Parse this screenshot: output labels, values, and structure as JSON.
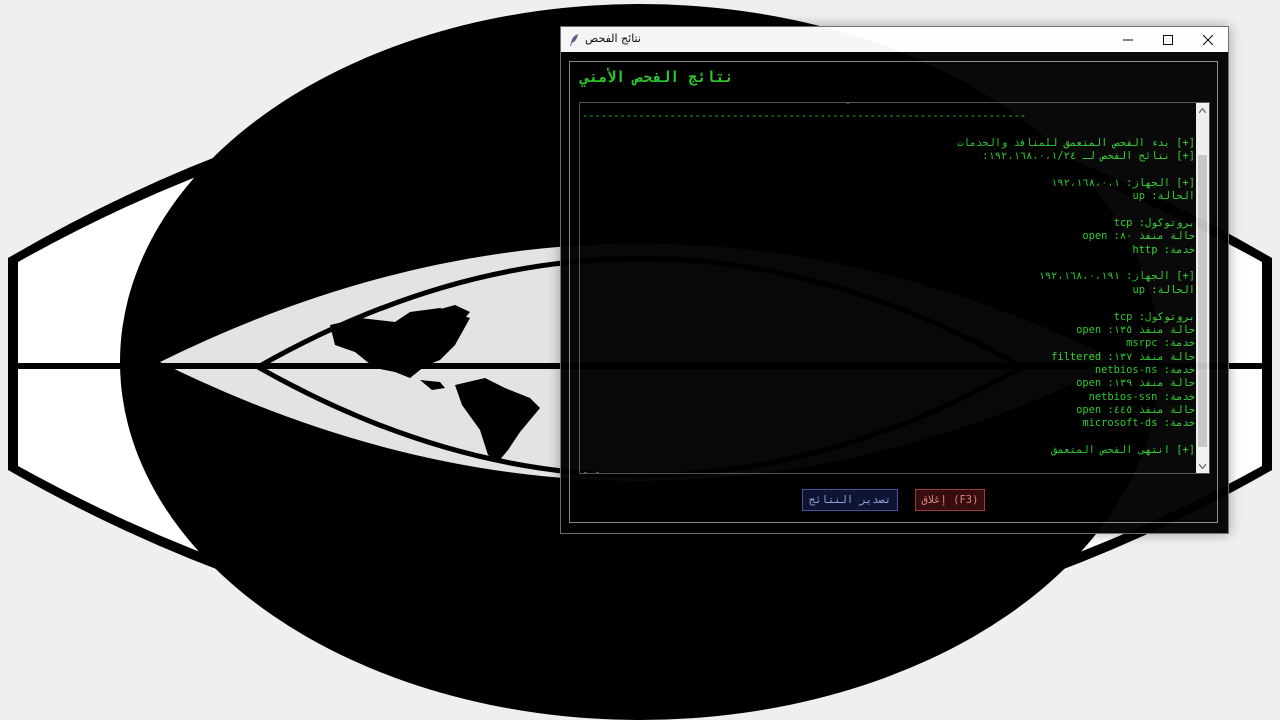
{
  "window": {
    "title": "نتائج الفحص",
    "header": "نتائج الفحص الأمني"
  },
  "results": {
    "lines": [
      "                                          -",
      "-----------------------------------------------------------------------",
      "",
      "[+] بدء الفحص المتعمق للمنافذ والخدمات",
      "[+] نتائج الفحص لـ ١٩٢،١٦٨،٠،١/٢٤:",
      "",
      "[+] الجهاز: ١٩٢،١٦٨،٠،١",
      "الحالة: up",
      "",
      "بروتوكول: tcp",
      "حالة منفذ ٨٠: open",
      "خدمة: http",
      "",
      "[+] الجهاز: ١٩٢،١٦٨،٠،١٩١",
      "الحالة: up",
      "",
      "بروتوكول: tcp",
      "حالة منفذ ١٣٥: open",
      "خدمة: msrpc",
      "حالة منفذ ١٣٧: filtered",
      "خدمة: netbios-ns",
      "حالة منفذ ١٣٩: open",
      "خدمة: netbios-ssn",
      "حالة منفذ ٤٤٥: open",
      "خدمة: microsoft-ds",
      "",
      "[+] انتهى الفحص المتعمق",
      "",
      "[+] ..."
    ]
  },
  "buttons": {
    "export_label": "تصدير النتائج",
    "close_label": "(F3) إغلاق"
  },
  "colors": {
    "terminal_text": "#2fd12f",
    "export_button": "#0f1636",
    "close_button": "#3a0d0d"
  },
  "icons": {
    "app": "feather-icon",
    "minimize": "minimize-icon",
    "maximize": "maximize-icon",
    "close": "close-icon"
  }
}
